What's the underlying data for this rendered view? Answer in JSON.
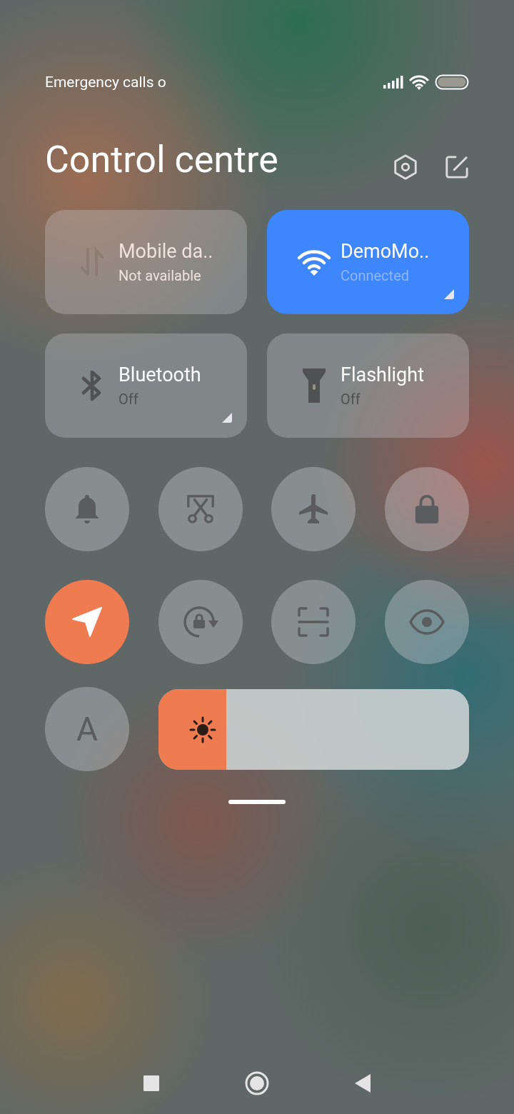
{
  "status_bar": {
    "carrier_text": "Emergency calls o"
  },
  "header": {
    "title": "Control centre"
  },
  "tiles": [
    {
      "kind": "mobile-data",
      "title": "Mobile da..",
      "subtitle": "Not available",
      "on": false,
      "disabled": true,
      "expandable": false
    },
    {
      "kind": "wifi",
      "title": "DemoMo..",
      "subtitle": "Connected",
      "on": true,
      "disabled": false,
      "expandable": true
    },
    {
      "kind": "bluetooth",
      "title": "Bluetooth",
      "subtitle": "Off",
      "on": false,
      "disabled": false,
      "expandable": true
    },
    {
      "kind": "flashlight",
      "title": "Flashlight",
      "subtitle": "Off",
      "on": false,
      "disabled": false,
      "expandable": false
    }
  ],
  "toggles": [
    {
      "kind": "bell",
      "on": false
    },
    {
      "kind": "screenshot",
      "on": false
    },
    {
      "kind": "airplane",
      "on": false
    },
    {
      "kind": "lock",
      "on": false
    },
    {
      "kind": "location",
      "on": true
    },
    {
      "kind": "rotation-lock",
      "on": false
    },
    {
      "kind": "scanner",
      "on": false
    },
    {
      "kind": "eye",
      "on": false
    }
  ],
  "font_toggle": {
    "label": "A",
    "on": false
  },
  "brightness": {
    "level": 0.22
  }
}
